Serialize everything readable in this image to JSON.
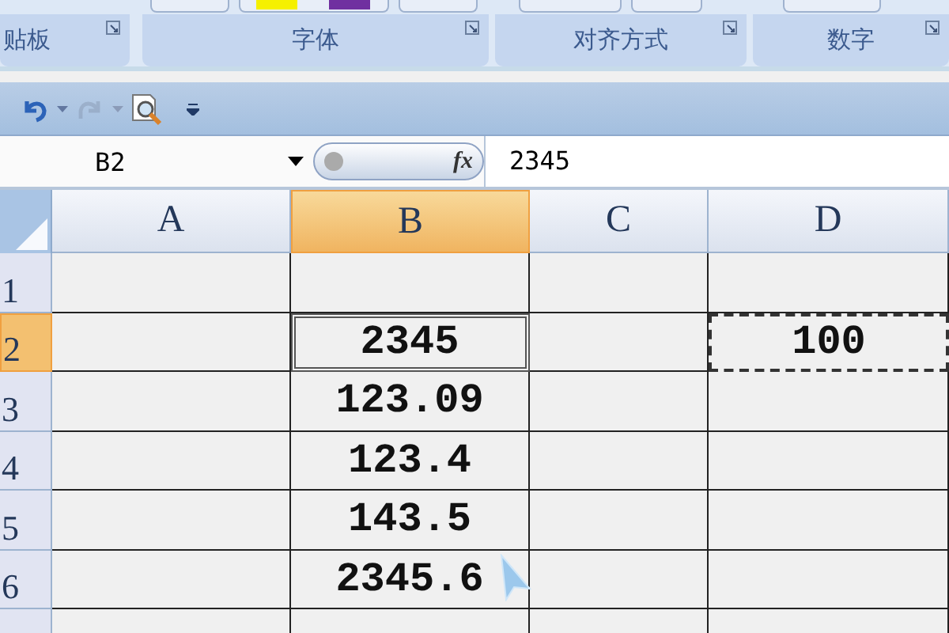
{
  "ribbon": {
    "groups": [
      {
        "label": "贴板"
      },
      {
        "label": "字体"
      },
      {
        "label": "对齐方式"
      },
      {
        "label": "数字"
      }
    ]
  },
  "quick_access": {
    "undo_disabled": false,
    "redo_disabled": true
  },
  "formula_bar": {
    "name_box": "B2",
    "fx_label": "fx",
    "value": "2345"
  },
  "sheet": {
    "columns": [
      {
        "label": "A",
        "selected": false
      },
      {
        "label": "B",
        "selected": true
      },
      {
        "label": "C",
        "selected": false
      },
      {
        "label": "D",
        "selected": false
      }
    ],
    "rows": [
      {
        "label": "1",
        "selected": false,
        "cells": [
          null,
          null,
          null,
          null
        ]
      },
      {
        "label": "2",
        "selected": true,
        "cells": [
          null,
          {
            "text": "2345",
            "active": true,
            "copied": false
          },
          null,
          {
            "text": "100",
            "active": false,
            "copied": true
          }
        ]
      },
      {
        "label": "3",
        "selected": false,
        "cells": [
          null,
          {
            "text": "123.09",
            "active": false,
            "copied": false
          },
          null,
          null
        ]
      },
      {
        "label": "4",
        "selected": false,
        "cells": [
          null,
          {
            "text": "123.4",
            "active": false,
            "copied": false
          },
          null,
          null
        ]
      },
      {
        "label": "5",
        "selected": false,
        "cells": [
          null,
          {
            "text": "143.5",
            "active": false,
            "copied": false
          },
          null,
          null
        ]
      },
      {
        "label": "6",
        "selected": false,
        "cells": [
          null,
          {
            "text": "2345.6",
            "active": false,
            "copied": false
          },
          null,
          null
        ]
      }
    ]
  }
}
